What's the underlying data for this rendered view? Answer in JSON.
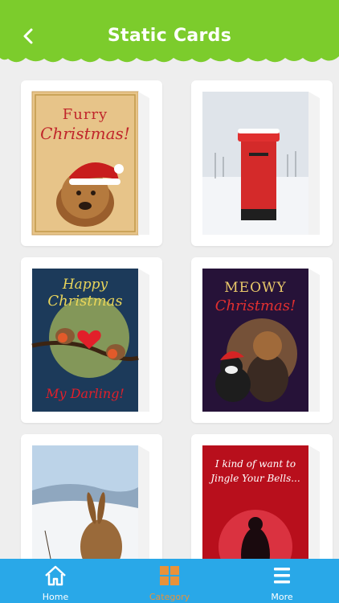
{
  "header": {
    "title": "Static Cards",
    "back_icon": "chevron-left-icon",
    "color": "#7ccc2c"
  },
  "cards": [
    {
      "line1": "Furry",
      "line2": "Christmas!"
    },
    {
      "line1": "",
      "line2": ""
    },
    {
      "line1": "Happy",
      "line2": "Christmas",
      "line3": "My Darling!"
    },
    {
      "line1": "MEOWY",
      "line2": "Christmas!"
    },
    {
      "line1": "",
      "line2": ""
    },
    {
      "line1": "I kind of want to",
      "line2": "Jingle Your Bells..."
    }
  ],
  "bottom_nav": {
    "items": [
      {
        "label": "Home",
        "icon": "home-icon"
      },
      {
        "label": "Category",
        "icon": "grid-icon",
        "active": true
      },
      {
        "label": "More",
        "icon": "menu-icon"
      }
    ],
    "color": "#29a8e8",
    "active_color": "#e8923a"
  }
}
